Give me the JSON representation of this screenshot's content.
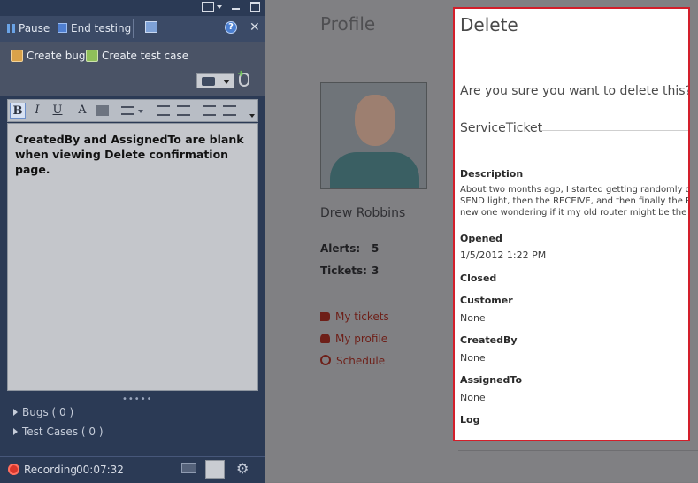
{
  "panel": {
    "commands": {
      "pause": "Pause",
      "end_testing": "End testing"
    },
    "bug_actions": {
      "create_bug": "Create bug",
      "create_test_case": "Create test case"
    },
    "note_text": "CreatedBy and AssignedTo are blank when viewing Delete confirmation page.",
    "tree": {
      "bugs": "Bugs ( 0 )",
      "test_cases": "Test Cases ( 0 )"
    },
    "status": {
      "recording": "Recording",
      "elapsed": "00:07:32"
    },
    "toolbar": {
      "bold": "B",
      "italic": "I",
      "underline": "U",
      "font_color": "A"
    }
  },
  "page": {
    "title": "Profile",
    "user_name": "Drew Robbins",
    "stats": {
      "alerts_label": "Alerts:",
      "alerts_value": "5",
      "tickets_label": "Tickets:",
      "tickets_value": "3"
    },
    "nav": {
      "my_tickets": "My tickets",
      "my_profile": "My profile",
      "schedule": "Schedule"
    }
  },
  "dialog": {
    "title": "Delete",
    "question": "Are you sure you want to delete this?",
    "entity": "ServiceTicket",
    "fields": {
      "description_label": "Description",
      "description_lines": [
        "About two months ago, I started getting randomly d",
        "SEND light, then the RECEIVE, and then finally the PO",
        "new one wondering if it my old router might be the p"
      ],
      "opened_label": "Opened",
      "opened_value": "1/5/2012 1:22 PM",
      "closed_label": "Closed",
      "customer_label": "Customer",
      "customer_value": "None",
      "createdby_label": "CreatedBy",
      "createdby_value": "None",
      "assignedto_label": "AssignedTo",
      "assignedto_value": "None",
      "log_label": "Log"
    }
  },
  "colors": {
    "highlight_border": "#d31e2a",
    "panel_bg": "#2b3a55",
    "link": "#6e1f18"
  }
}
